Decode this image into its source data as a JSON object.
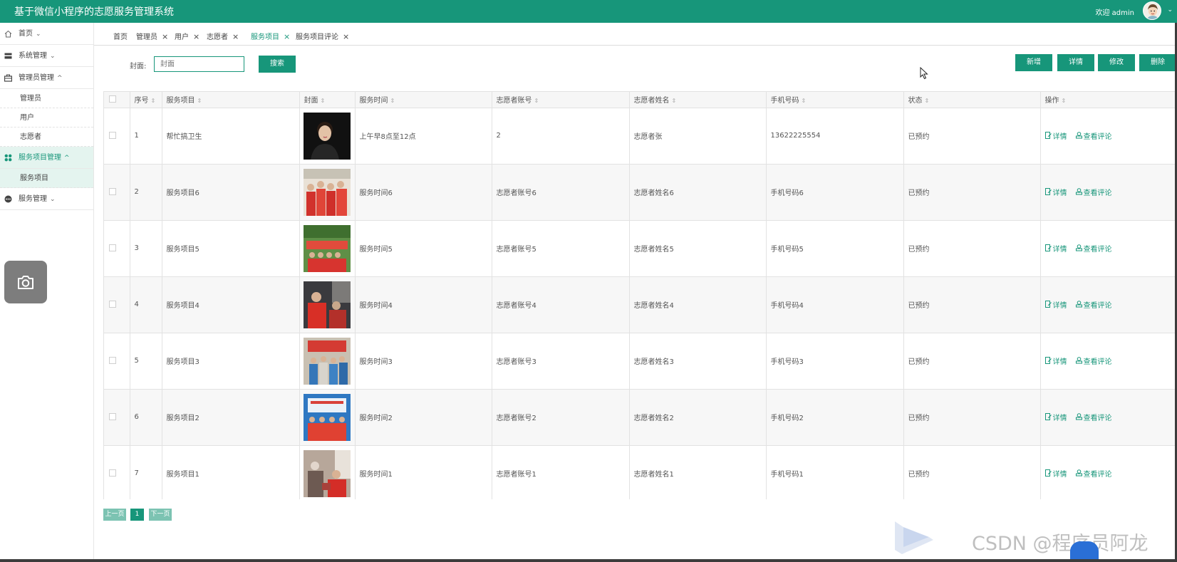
{
  "header": {
    "title": "基于微信小程序的志愿服务管理系统",
    "welcome": "欢迎 admin",
    "chevron": "⌄"
  },
  "sidebar": {
    "items": [
      {
        "label": "首页",
        "icon": "home-icon",
        "chevron": "⌄"
      },
      {
        "label": "系统管理",
        "icon": "settings-icon",
        "chevron": "⌄"
      },
      {
        "label": "管理员管理",
        "icon": "briefcase-icon",
        "chevron": "^"
      },
      {
        "label": "服务项目管理",
        "icon": "grid-icon",
        "chevron": "^"
      },
      {
        "label": "服务管理",
        "icon": "more-icon",
        "chevron": "⌄"
      }
    ],
    "admin_sub": [
      "管理员",
      "用户",
      "志愿者"
    ],
    "service_sub": [
      "服务项目"
    ]
  },
  "tabs": [
    {
      "label": "首页",
      "closable": false
    },
    {
      "label": "管理员",
      "closable": true
    },
    {
      "label": "用户",
      "closable": true
    },
    {
      "label": "志愿者",
      "closable": true
    },
    {
      "label": "服务项目",
      "closable": true,
      "active": true
    },
    {
      "label": "服务项目评论",
      "closable": true
    }
  ],
  "tab_close": "×",
  "search": {
    "label": "封面:",
    "placeholder": "封面",
    "button": "搜索"
  },
  "actions": {
    "add": "新增",
    "detail": "详情",
    "edit": "修改",
    "delete": "删除"
  },
  "table": {
    "sort_glyph": "⇕",
    "columns": [
      "序号",
      "服务项目",
      "封面",
      "服务时间",
      "志愿者账号",
      "志愿者姓名",
      "手机号码",
      "状态",
      "操作"
    ],
    "rows": [
      {
        "index": "1",
        "project": "帮忙搞卫生",
        "time": "上午早8点至12点",
        "account": "2",
        "name": "志愿者张",
        "phone": "13622225554",
        "status": "已预约",
        "cover": "portrait"
      },
      {
        "index": "2",
        "project": "服务项目6",
        "time": "服务时间6",
        "account": "志愿者账号6",
        "name": "志愿者姓名6",
        "phone": "手机号码6",
        "status": "已预约",
        "cover": "group-red"
      },
      {
        "index": "3",
        "project": "服务项目5",
        "time": "服务时间5",
        "account": "志愿者账号5",
        "name": "志愿者姓名5",
        "phone": "手机号码5",
        "status": "已预约",
        "cover": "banner-green"
      },
      {
        "index": "4",
        "project": "服务项目4",
        "time": "服务时间4",
        "account": "志愿者账号4",
        "name": "志愿者姓名4",
        "phone": "手机号码4",
        "status": "已预约",
        "cover": "indoor-red"
      },
      {
        "index": "5",
        "project": "服务项目3",
        "time": "服务时间3",
        "account": "志愿者账号3",
        "name": "志愿者姓名3",
        "phone": "手机号码3",
        "status": "已预约",
        "cover": "crowd-blue"
      },
      {
        "index": "6",
        "project": "服务项目2",
        "time": "服务时间2",
        "account": "志愿者账号2",
        "name": "志愿者姓名2",
        "phone": "手机号码2",
        "status": "已预约",
        "cover": "stage-blue"
      },
      {
        "index": "7",
        "project": "服务项目1",
        "time": "服务时间1",
        "account": "志愿者账号1",
        "name": "志愿者姓名1",
        "phone": "手机号码1",
        "status": "已预约",
        "cover": "elderly-red"
      }
    ],
    "op_detail": "详情",
    "op_comments": "查看评论"
  },
  "pager": {
    "prev": "上一页",
    "current": "1",
    "next": "下一页"
  },
  "watermark": "CSDN @程序员阿龙",
  "colors": {
    "primary": "#17967a",
    "pager_light": "#7cc3b2",
    "active_bg": "#e4f4ef"
  }
}
